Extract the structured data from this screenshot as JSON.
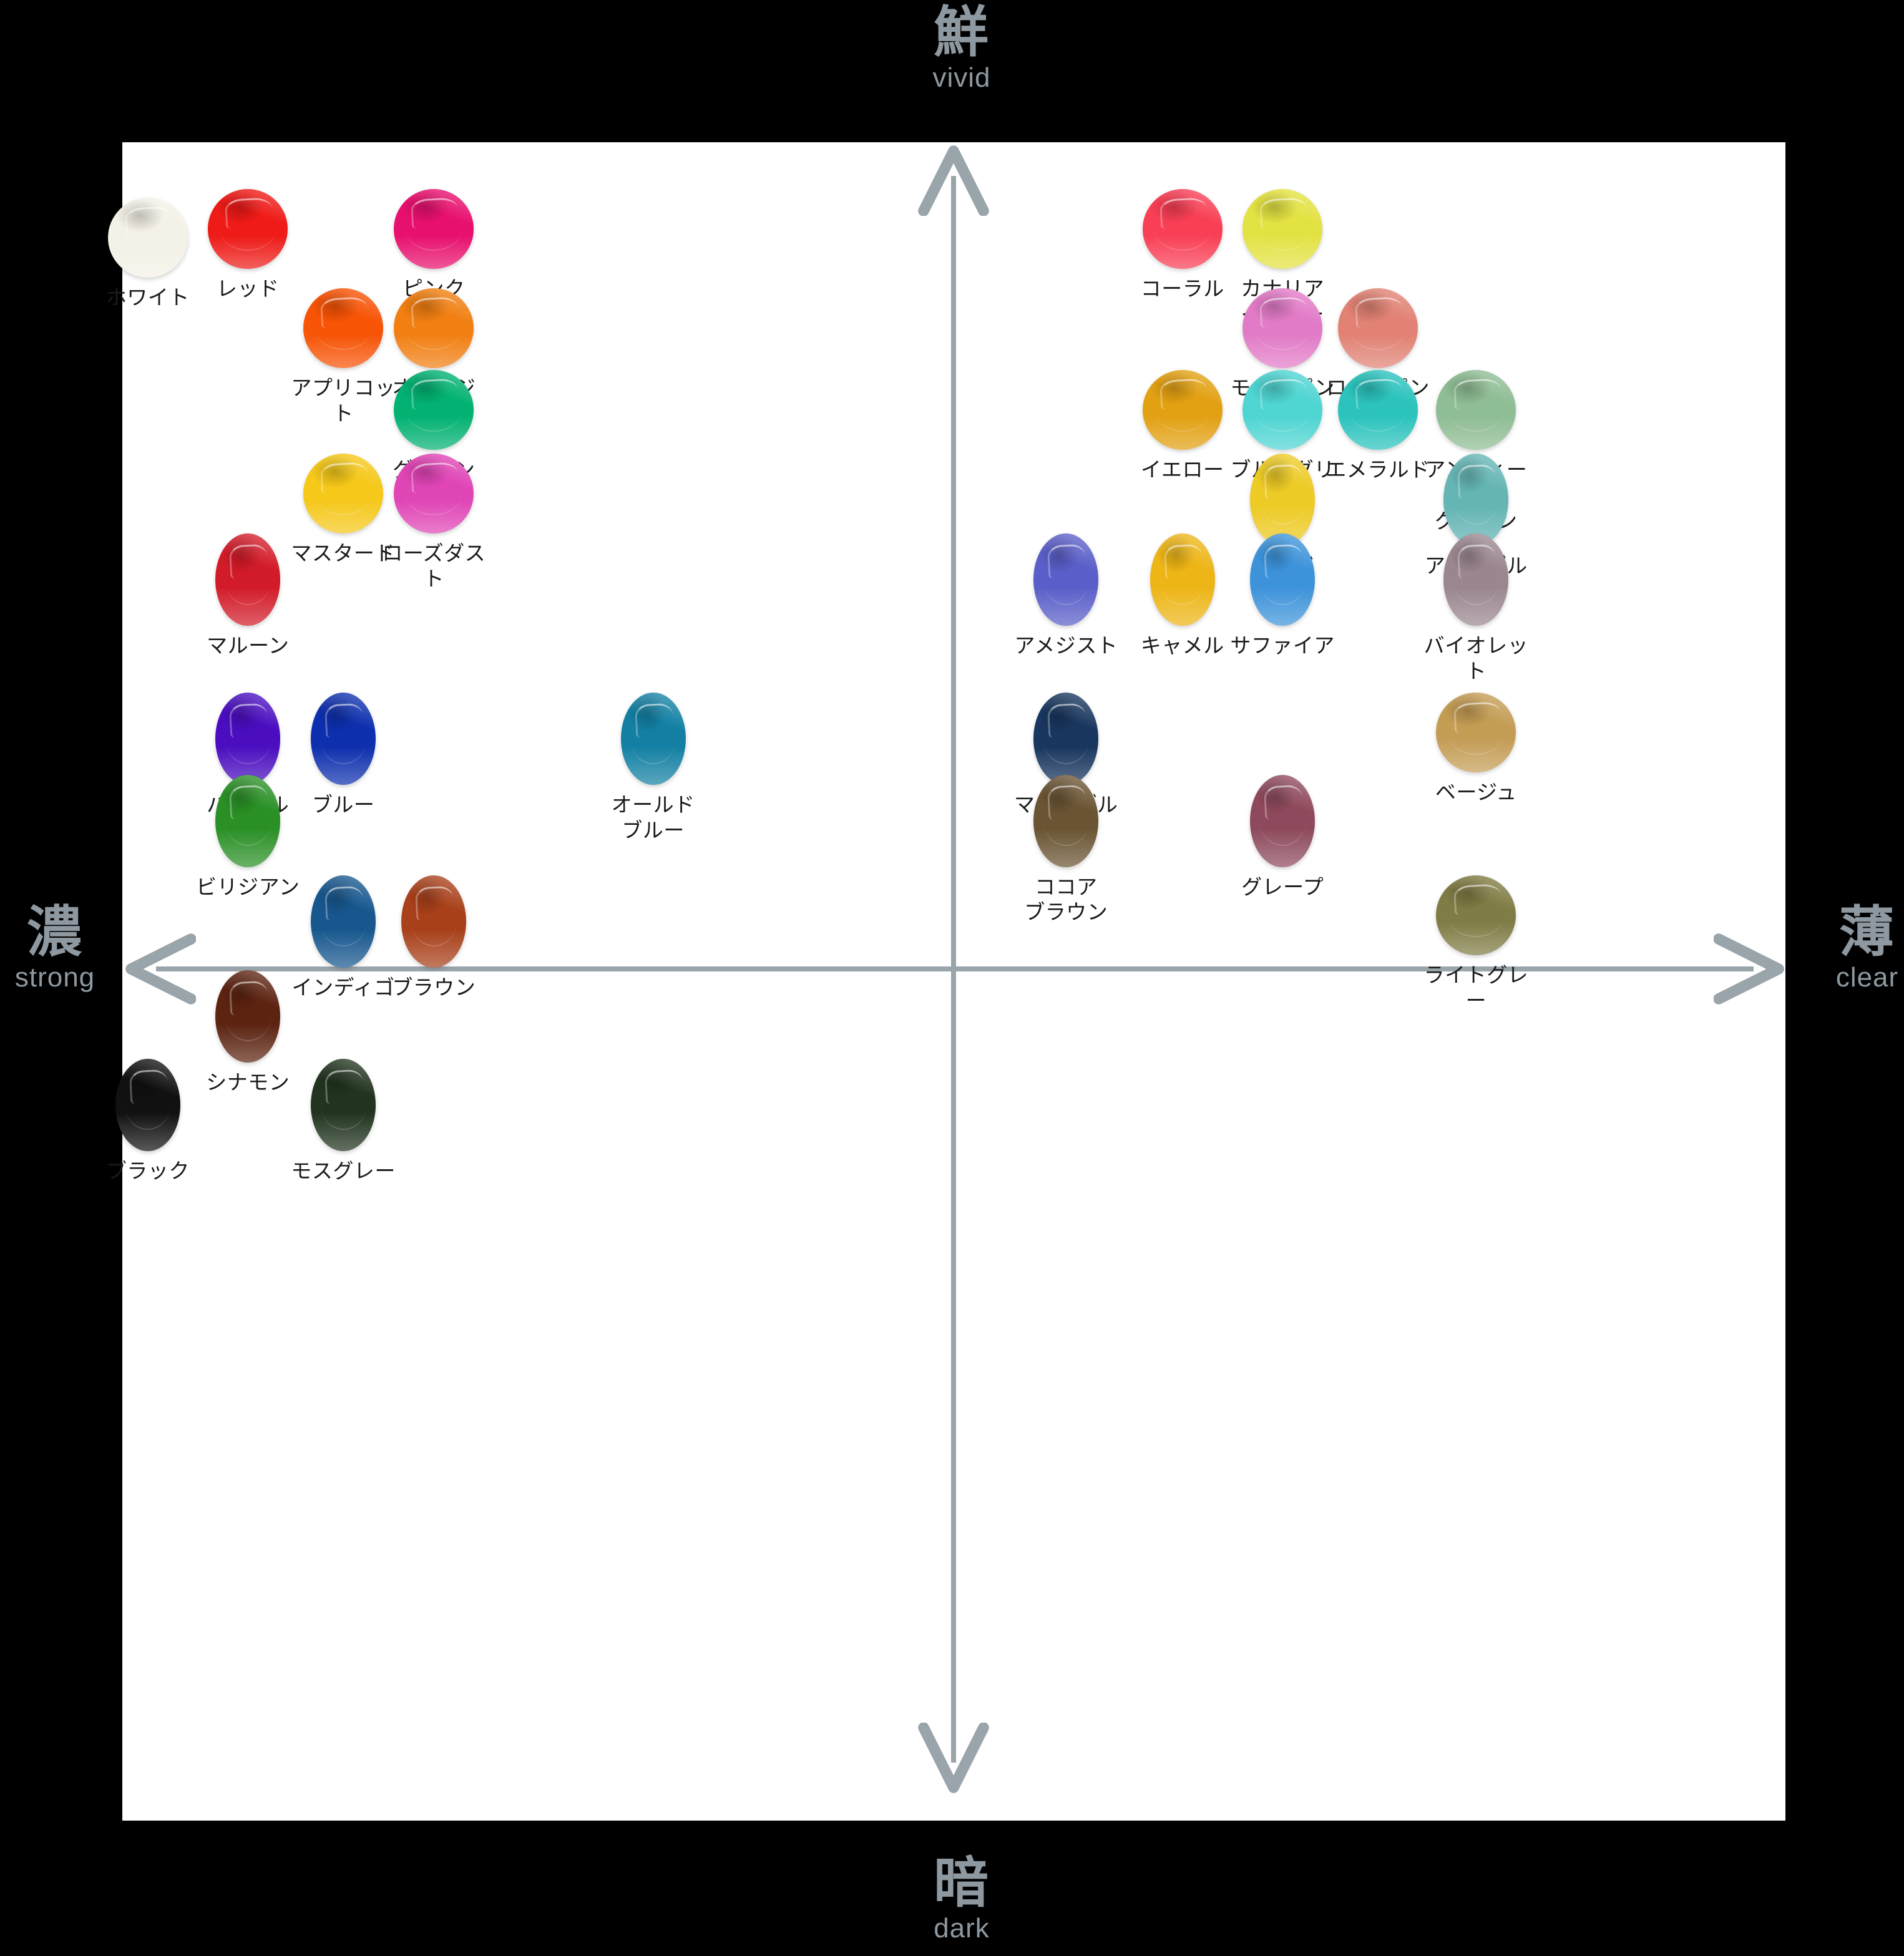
{
  "axes": {
    "top": {
      "kanji": "鮮",
      "roman": "vivid"
    },
    "bottom": {
      "kanji": "暗",
      "roman": "dark"
    },
    "left": {
      "kanji": "濃",
      "roman": "strong"
    },
    "right": {
      "kanji": "薄",
      "roman": "clear"
    }
  },
  "chart_data": {
    "type": "scatter",
    "title": "",
    "xlabel": "濃 strong ← → 薄 clear",
    "ylabel": "鮮 vivid ↑ ↓ 暗 dark",
    "xlim": [
      -1,
      1
    ],
    "ylim": [
      -1,
      1
    ],
    "grid": false,
    "legend": null,
    "annotations": [
      "鮮 vivid",
      "暗 dark",
      "濃 strong",
      "薄 clear"
    ],
    "points": [
      {
        "label": "ホワイト",
        "color": "#f4f1e6",
        "x": -0.845,
        "y": 0.845,
        "shape": "round"
      },
      {
        "label": "レッド",
        "color": "#ee1b18",
        "x": -0.74,
        "y": 0.855,
        "shape": "round"
      },
      {
        "label": "ピンク",
        "color": "#e8106e",
        "x": -0.545,
        "y": 0.855,
        "shape": "round"
      },
      {
        "label": "アプリコット",
        "color": "#f75406",
        "x": -0.64,
        "y": 0.74,
        "shape": "round"
      },
      {
        "label": "オレンジ",
        "color": "#f17f12",
        "x": -0.545,
        "y": 0.74,
        "shape": "round"
      },
      {
        "label": "グリーン",
        "color": "#03b272",
        "x": -0.545,
        "y": 0.645,
        "shape": "round"
      },
      {
        "label": "マスタード",
        "color": "#f5c81a",
        "x": -0.64,
        "y": 0.548,
        "shape": "round"
      },
      {
        "label": "ローズダスト",
        "color": "#e045b6",
        "x": -0.545,
        "y": 0.548,
        "shape": "round"
      },
      {
        "label": "マルーン",
        "color": "#d21b28",
        "x": -0.74,
        "y": 0.455,
        "shape": "oval"
      },
      {
        "label": "パープル",
        "color": "#4a0ec0",
        "x": -0.74,
        "y": 0.27,
        "shape": "oval"
      },
      {
        "label": "ブルー",
        "color": "#0d2fae",
        "x": -0.64,
        "y": 0.27,
        "shape": "oval"
      },
      {
        "label": "オールド\nブルー",
        "color": "#1380a3",
        "x": -0.315,
        "y": 0.27,
        "shape": "oval"
      },
      {
        "label": "ビリジアン",
        "color": "#2a9026",
        "x": -0.74,
        "y": 0.175,
        "shape": "oval"
      },
      {
        "label": "インディゴ",
        "color": "#17578e",
        "x": -0.64,
        "y": 0.058,
        "shape": "oval"
      },
      {
        "label": "ブラウン",
        "color": "#a8401a",
        "x": -0.545,
        "y": 0.058,
        "shape": "oval"
      },
      {
        "label": "シナモン",
        "color": "#5c2310",
        "x": -0.74,
        "y": -0.052,
        "shape": "oval"
      },
      {
        "label": "ブラック",
        "color": "#111111",
        "x": -0.845,
        "y": -0.155,
        "shape": "oval"
      },
      {
        "label": "モスグレー",
        "color": "#22341f",
        "x": -0.64,
        "y": -0.155,
        "shape": "oval"
      },
      {
        "label": "コーラル",
        "color": "#f93f55",
        "x": 0.24,
        "y": 0.855,
        "shape": "round"
      },
      {
        "label": "カナリア\nイエロー",
        "color": "#e3e243",
        "x": 0.345,
        "y": 0.855,
        "shape": "round"
      },
      {
        "label": "モーヴピンク",
        "color": "#e27bc7",
        "x": 0.345,
        "y": 0.74,
        "shape": "round"
      },
      {
        "label": "ローズピンク",
        "color": "#e18274",
        "x": 0.445,
        "y": 0.74,
        "shape": "round"
      },
      {
        "label": "イエロー",
        "color": "#e2a113",
        "x": 0.24,
        "y": 0.645,
        "shape": "round"
      },
      {
        "label": "ブルーグリーン",
        "color": "#4fd5d2",
        "x": 0.345,
        "y": 0.645,
        "shape": "round"
      },
      {
        "label": "エメラルド",
        "color": "#2cc3bd",
        "x": 0.445,
        "y": 0.645,
        "shape": "round"
      },
      {
        "label": "アンティーク\nグリーン",
        "color": "#8fbd94",
        "x": 0.548,
        "y": 0.645,
        "shape": "round"
      },
      {
        "label": "ミモザ",
        "color": "#edcb26",
        "x": 0.345,
        "y": 0.548,
        "shape": "oval"
      },
      {
        "label": "アイスブルー",
        "color": "#65b5b5",
        "x": 0.548,
        "y": 0.548,
        "shape": "oval"
      },
      {
        "label": "アメジスト",
        "color": "#5a5ec8",
        "x": 0.118,
        "y": 0.455,
        "shape": "oval"
      },
      {
        "label": "キャメル",
        "color": "#edb516",
        "x": 0.24,
        "y": 0.455,
        "shape": "oval"
      },
      {
        "label": "サファイア",
        "color": "#3d93da",
        "x": 0.345,
        "y": 0.455,
        "shape": "oval"
      },
      {
        "label": "バイオレット",
        "color": "#9b8690",
        "x": 0.548,
        "y": 0.455,
        "shape": "oval"
      },
      {
        "label": "マリンブルー",
        "color": "#18365e",
        "x": 0.118,
        "y": 0.27,
        "shape": "oval"
      },
      {
        "label": "ベージュ",
        "color": "#c49d55",
        "x": 0.548,
        "y": 0.27,
        "shape": "round"
      },
      {
        "label": "ココア\nブラウン",
        "color": "#6a5433",
        "x": 0.118,
        "y": 0.175,
        "shape": "oval"
      },
      {
        "label": "グレープ",
        "color": "#8e4a5c",
        "x": 0.345,
        "y": 0.175,
        "shape": "oval"
      },
      {
        "label": "ライトグレー",
        "color": "#807c45",
        "x": 0.548,
        "y": 0.058,
        "shape": "round"
      }
    ]
  }
}
